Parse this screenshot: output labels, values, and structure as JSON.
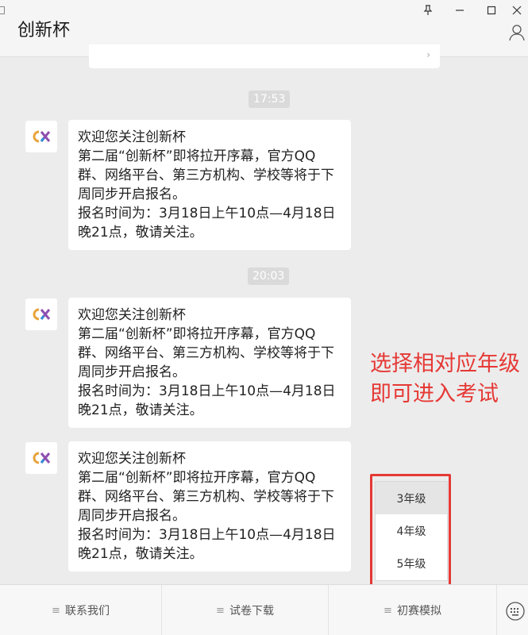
{
  "window": {
    "title": "创新杯",
    "pin_icon": "pin-icon",
    "minimize_icon": "minimize-icon",
    "maximize_icon": "maximize-icon",
    "close_icon": "close-icon",
    "contact_icon": "person-icon"
  },
  "messages": [
    {
      "time": "17:53",
      "lines": [
        "欢迎您关注创新杯",
        "第二届“创新杯”即将拉开序幕，官方QQ",
        "群、网络平台、第三方机构、学校等将于下",
        "周同步开启报名。",
        "报名时间为：3月18日上午10点—4月18日",
        "晚21点，敬请关注。"
      ]
    },
    {
      "time": "20:03",
      "lines": [
        "欢迎您关注创新杯",
        "第二届“创新杯”即将拉开序幕，官方QQ",
        "群、网络平台、第三方机构、学校等将于下",
        "周同步开启报名。",
        "报名时间为：3月18日上午10点—4月18日",
        "晚21点，敬请关注。"
      ]
    },
    {
      "lines": [
        "欢迎您关注创新杯",
        "第二届“创新杯”即将拉开序幕，官方QQ",
        "群、网络平台、第三方机构、学校等将于下",
        "周同步开启报名。",
        "报名时间为：3月18日上午10点—4月18日",
        "晚21点，敬请关注。"
      ]
    }
  ],
  "annotation": {
    "line1": "选择相对应年级",
    "line2": "即可进入考试",
    "color": "#e53935"
  },
  "popup_menu": {
    "items": [
      "3年级",
      "4年级",
      "5年级"
    ],
    "highlighted": "3年级"
  },
  "bottom_menu": {
    "items": [
      "联系我们",
      "试卷下载",
      "初赛模拟"
    ]
  },
  "colors": {
    "background": "#ececec",
    "bubble": "#ffffff",
    "accent_red": "#e53935"
  }
}
